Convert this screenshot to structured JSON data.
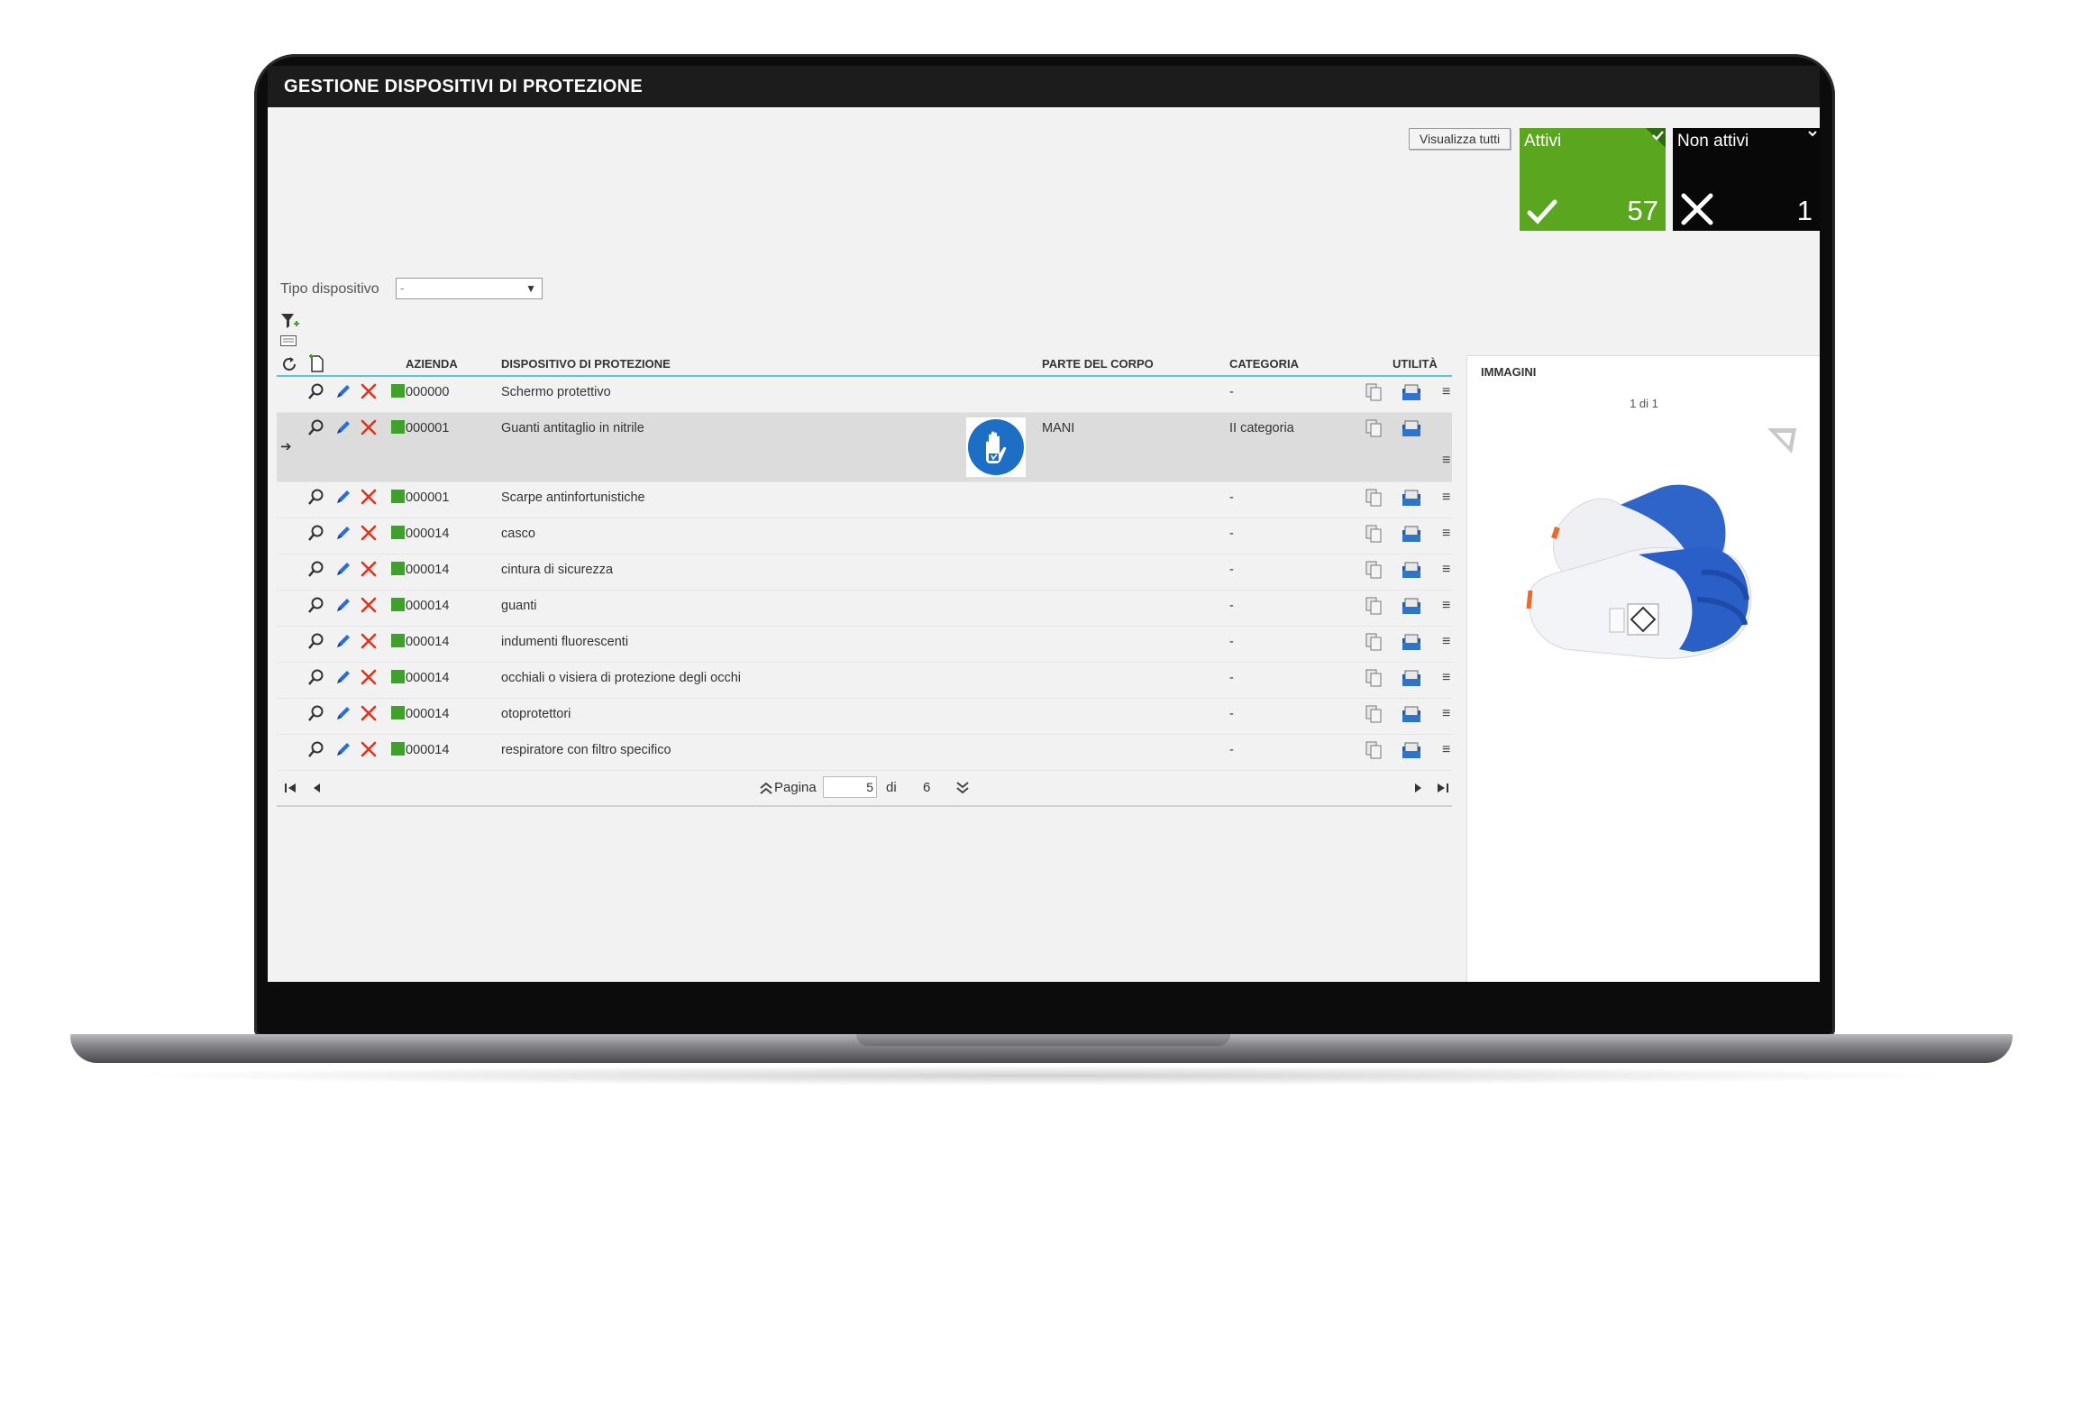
{
  "window": {
    "title": "GESTIONE DISPOSITIVI DI PROTEZIONE"
  },
  "toolbar": {
    "view_all_label": "Visualizza tutti"
  },
  "tiles": {
    "active": {
      "label": "Attivi",
      "count": "57",
      "color": "#5aa61f"
    },
    "inactive": {
      "label": "Non attivi",
      "count": "1",
      "color": "#080808"
    }
  },
  "filter": {
    "label": "Tipo dispositivo",
    "selected": "-"
  },
  "columns": {
    "azienda": "AZIENDA",
    "dispositivo": "DISPOSITIVO DI PROTEZIONE",
    "parte": "PARTE DEL CORPO",
    "categoria": "CATEGORIA",
    "utilita": "UTILITÀ"
  },
  "rows": [
    {
      "azienda": "000000",
      "dispositivo": "Schermo protettivo",
      "parte": "",
      "categoria": "-"
    },
    {
      "azienda": "000001",
      "dispositivo": "Guanti antitaglio in nitrile",
      "parte": "MANI",
      "categoria": "II categoria"
    },
    {
      "azienda": "000001",
      "dispositivo": "Scarpe antinfortunistiche",
      "parte": "",
      "categoria": "-"
    },
    {
      "azienda": "000014",
      "dispositivo": "casco",
      "parte": "",
      "categoria": "-"
    },
    {
      "azienda": "000014",
      "dispositivo": "cintura di sicurezza",
      "parte": "",
      "categoria": "-"
    },
    {
      "azienda": "000014",
      "dispositivo": "guanti",
      "parte": "",
      "categoria": "-"
    },
    {
      "azienda": "000014",
      "dispositivo": "indumenti fluorescenti",
      "parte": "",
      "categoria": "-"
    },
    {
      "azienda": "000014",
      "dispositivo": "occhiali o visiera di protezione degli occhi",
      "parte": "",
      "categoria": "-"
    },
    {
      "azienda": "000014",
      "dispositivo": "otoprotettori",
      "parte": "",
      "categoria": "-"
    },
    {
      "azienda": "000014",
      "dispositivo": "respiratore con filtro specifico",
      "parte": "",
      "categoria": "-"
    }
  ],
  "pager": {
    "page_label": "Pagina",
    "current": "5",
    "of_label": "di",
    "total": "6"
  },
  "images_panel": {
    "title": "IMMAGINI",
    "counter": "1 di 1"
  },
  "icons": {
    "filter": "filter-add-icon",
    "keyboard": "keyboard-icon",
    "refresh": "refresh-icon",
    "new": "new-document-icon",
    "view": "search-icon",
    "edit": "pencil-icon",
    "delete": "delete-icon",
    "status": "status-active-icon",
    "copy": "copy-icon",
    "attach": "attachment-icon",
    "menu": "menu-icon",
    "hand_sign": "hand-protection-icon"
  }
}
